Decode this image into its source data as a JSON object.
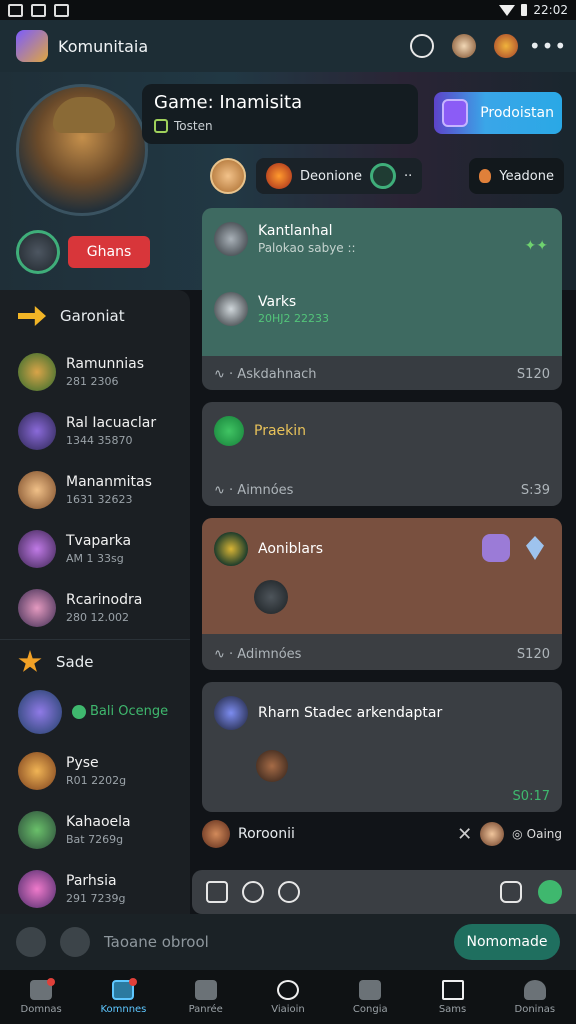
{
  "status": {
    "time": "22:02"
  },
  "appbar": {
    "title": "Komunitaia"
  },
  "hero": {
    "game_title": "Game: Inamisita",
    "game_sub": "Tosten",
    "cta_label": "Prodoistan",
    "pill_status": "Deonione",
    "pill_right": "Yeadone",
    "red_button": "Ghans"
  },
  "sidebar": {
    "header": "Garoniat",
    "items": [
      {
        "name": "Ramunnias",
        "meta": "281 2306"
      },
      {
        "name": "Ral Iacuaclar",
        "meta": "1344 35870"
      },
      {
        "name": "Mananmitas",
        "meta": "1631 32623"
      },
      {
        "name": "Tvaparka",
        "meta": "AM 1 33sg"
      },
      {
        "name": "Rcarinodra",
        "meta": "280 12.002"
      }
    ],
    "section2": "Sade",
    "items2": [
      {
        "name": "Bali Ocenge",
        "meta": ""
      },
      {
        "name": "Pyse",
        "meta": "R01 2202g"
      },
      {
        "name": "Kahaoela",
        "meta": "Bat 7269g"
      },
      {
        "name": "Parhsia",
        "meta": "291 7239g"
      }
    ]
  },
  "chat": {
    "cards": [
      {
        "msg1_name": "Kantlanhal",
        "msg1_text": "Palokao sabye ::",
        "msg2_name": "Varks",
        "msg2_time": "20HJ2 22233",
        "footer_left": "Askdahnach",
        "footer_right": "S120"
      },
      {
        "msg1_name": "Praekin",
        "footer_left": "Aimnóes",
        "footer_right": "S:39"
      },
      {
        "msg1_name": "Aoniblars",
        "footer_left": "Adimnóes",
        "footer_right": "S120"
      },
      {
        "msg1_name": "Rharn Stadec arkendaptar",
        "footer_right": "S0:17"
      }
    ],
    "reply_name": "Roroonii",
    "reply_cfg": "Oaing"
  },
  "input": {
    "placeholder": "Taoane obrool",
    "send_label": "Nomomade"
  },
  "nav": [
    "Domnas",
    "Komnnes",
    "Panrée",
    "Viaioin",
    "Congia",
    "Sams",
    "Doninas"
  ],
  "colors": {
    "accent": "#5ec7ff",
    "brand": "#3fb86e",
    "danger": "#d8363a"
  }
}
